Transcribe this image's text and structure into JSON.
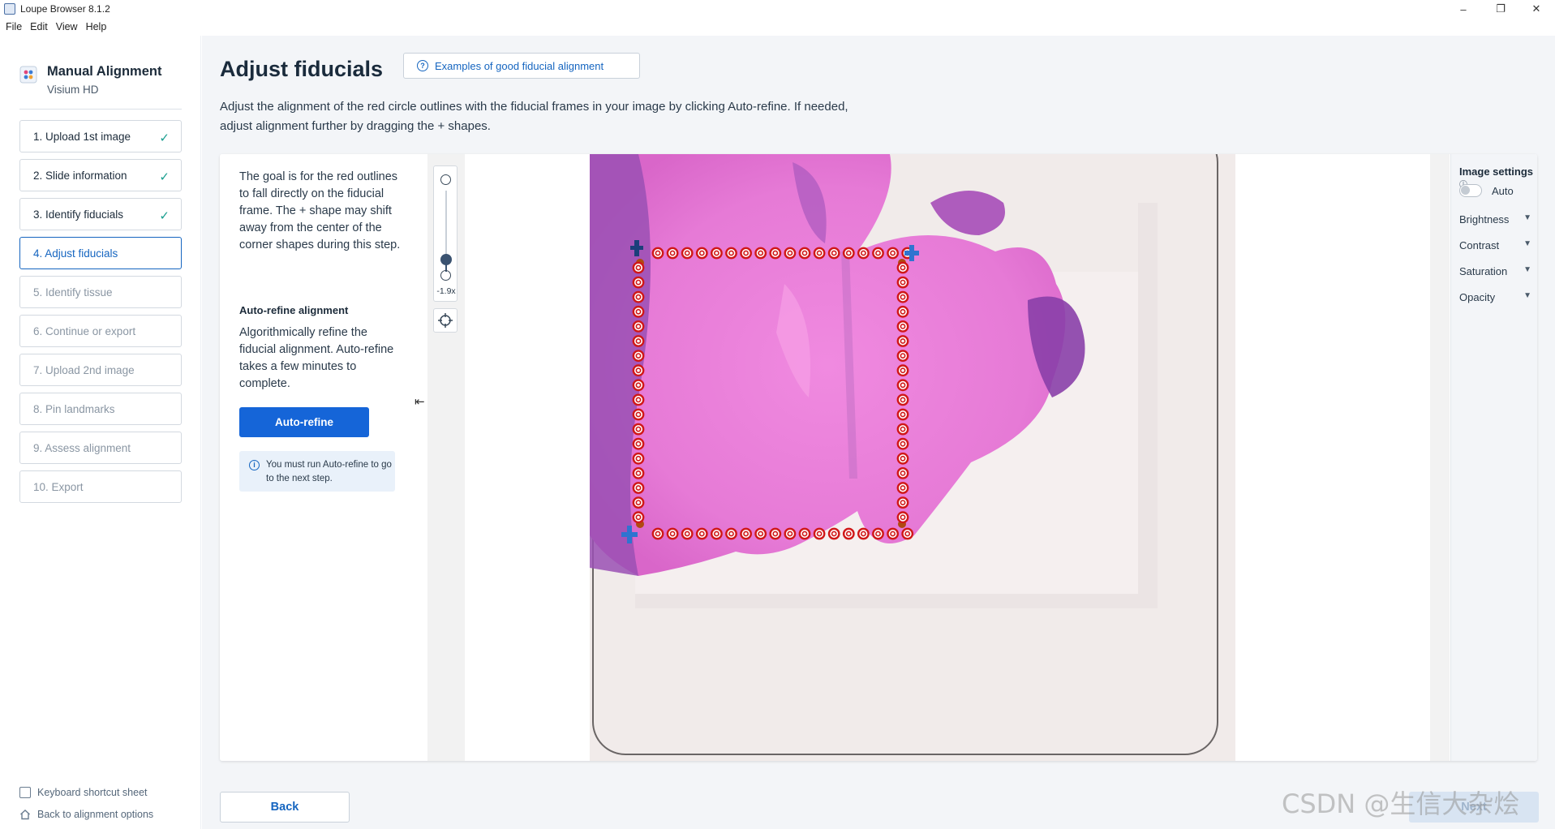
{
  "window": {
    "title": "Loupe Browser 8.1.2"
  },
  "menu": [
    "File",
    "Edit",
    "View",
    "Help"
  ],
  "sidebar": {
    "title": "Manual Alignment",
    "subtitle": "Visium HD",
    "steps": [
      {
        "label": "1. Upload 1st image",
        "state": "done"
      },
      {
        "label": "2. Slide information",
        "state": "done"
      },
      {
        "label": "3. Identify fiducials",
        "state": "done"
      },
      {
        "label": "4. Adjust fiducials",
        "state": "active"
      },
      {
        "label": "5. Identify tissue",
        "state": "pending"
      },
      {
        "label": "6. Continue or export",
        "state": "pending"
      },
      {
        "label": "7. Upload 2nd image",
        "state": "pending"
      },
      {
        "label": "8. Pin landmarks",
        "state": "pending"
      },
      {
        "label": "9. Assess alignment",
        "state": "pending"
      },
      {
        "label": "10. Export",
        "state": "pending"
      }
    ],
    "keyboard_link": "Keyboard shortcut sheet",
    "back_options_link": "Back to alignment options"
  },
  "main": {
    "title": "Adjust fiducials",
    "examples_button": "Examples of good fiducial alignment",
    "intro_line1": "Adjust the alignment of the red circle outlines with the fiducial frames in your image by clicking Auto-refine. If needed,",
    "intro_line2": "adjust alignment further by dragging the + shapes.",
    "goal_text": "The goal is for the red outlines to fall directly on the fiducial frame. The + shape may shift away from the center of the corner shapes during this step.",
    "auto_refine_title": "Auto-refine alignment",
    "auto_refine_desc": "Algorithmically refine the fiducial alignment. Auto-refine takes a few minutes to complete.",
    "auto_refine_button": "Auto-refine",
    "note": "You must run Auto-refine to go to the next step.",
    "zoom_value": "-1.9x"
  },
  "image_settings": {
    "title": "Image settings",
    "auto_label": "Auto",
    "auto_enabled": false,
    "controls": [
      "Brightness",
      "Contrast",
      "Saturation",
      "Opacity"
    ]
  },
  "footer": {
    "back_button": "Back",
    "next_button": "Next"
  },
  "watermark": "CSDN @生信大杂烩",
  "colors": {
    "accent": "#1565d8",
    "check": "#1a9e8f",
    "fiducial": "#d01818",
    "tissue": "#e07ad0"
  }
}
